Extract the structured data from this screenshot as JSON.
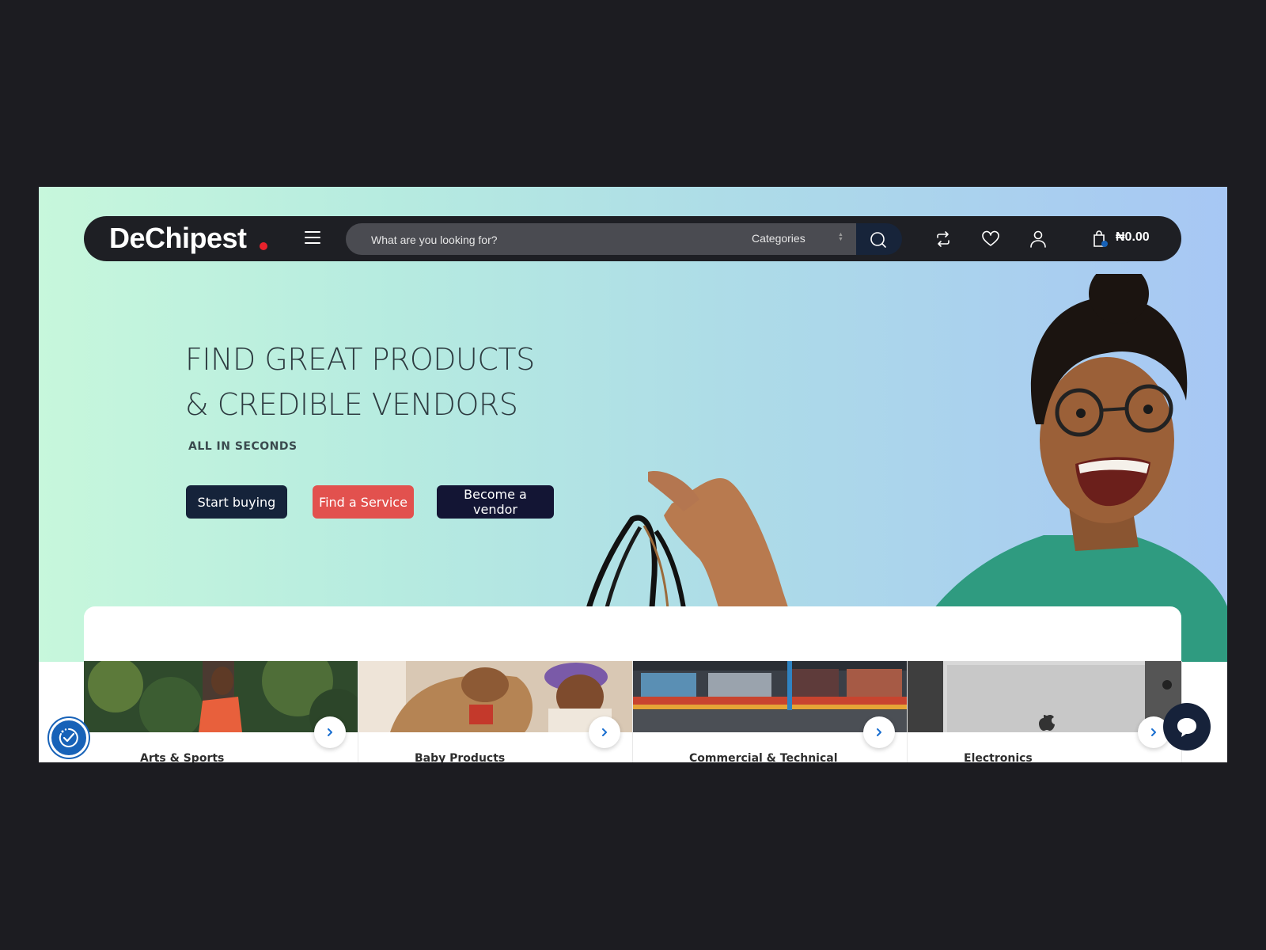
{
  "header": {
    "logo": "DeChipest",
    "search_placeholder": "What are you looking for?",
    "categories_label": "Categories",
    "cart_total": "₦0.00"
  },
  "hero": {
    "title_line1": "FIND GREAT PRODUCTS",
    "title_line2": "& CREDIBLE VENDORS",
    "subtitle": "ALL IN SECONDS",
    "buttons": {
      "start_buying": "Start buying",
      "find_service": "Find a Service",
      "become_vendor": "Become a vendor"
    }
  },
  "categories": [
    {
      "label": "Arts & Sports"
    },
    {
      "label": "Baby Products"
    },
    {
      "label": "Commercial & Technical"
    },
    {
      "label": "Electronics"
    }
  ],
  "colors": {
    "brand_dark": "#1e1f24",
    "accent_red": "#e2514e",
    "logo_dot": "#e8222c",
    "navy": "#15233a"
  }
}
